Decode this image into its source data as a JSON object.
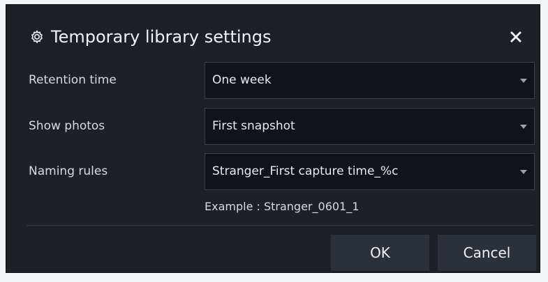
{
  "dialog": {
    "title": "Temporary library settings",
    "icons": {
      "title": "gear-icon",
      "close": "close-icon",
      "dropdown": "chevron-down-icon"
    }
  },
  "fields": [
    {
      "label": "Retention time",
      "value": "One week"
    },
    {
      "label": "Show photos",
      "value": "First snapshot"
    },
    {
      "label": "Naming rules",
      "value": "Stranger_First capture time_%c"
    }
  ],
  "example_text": "Example : Stranger_0601_1",
  "buttons": {
    "ok": "OK",
    "cancel": "Cancel"
  },
  "colors": {
    "dialog_background": "#1d2027",
    "field_background": "#111318",
    "button_background": "#2c3038",
    "text": "#e7eaee"
  }
}
